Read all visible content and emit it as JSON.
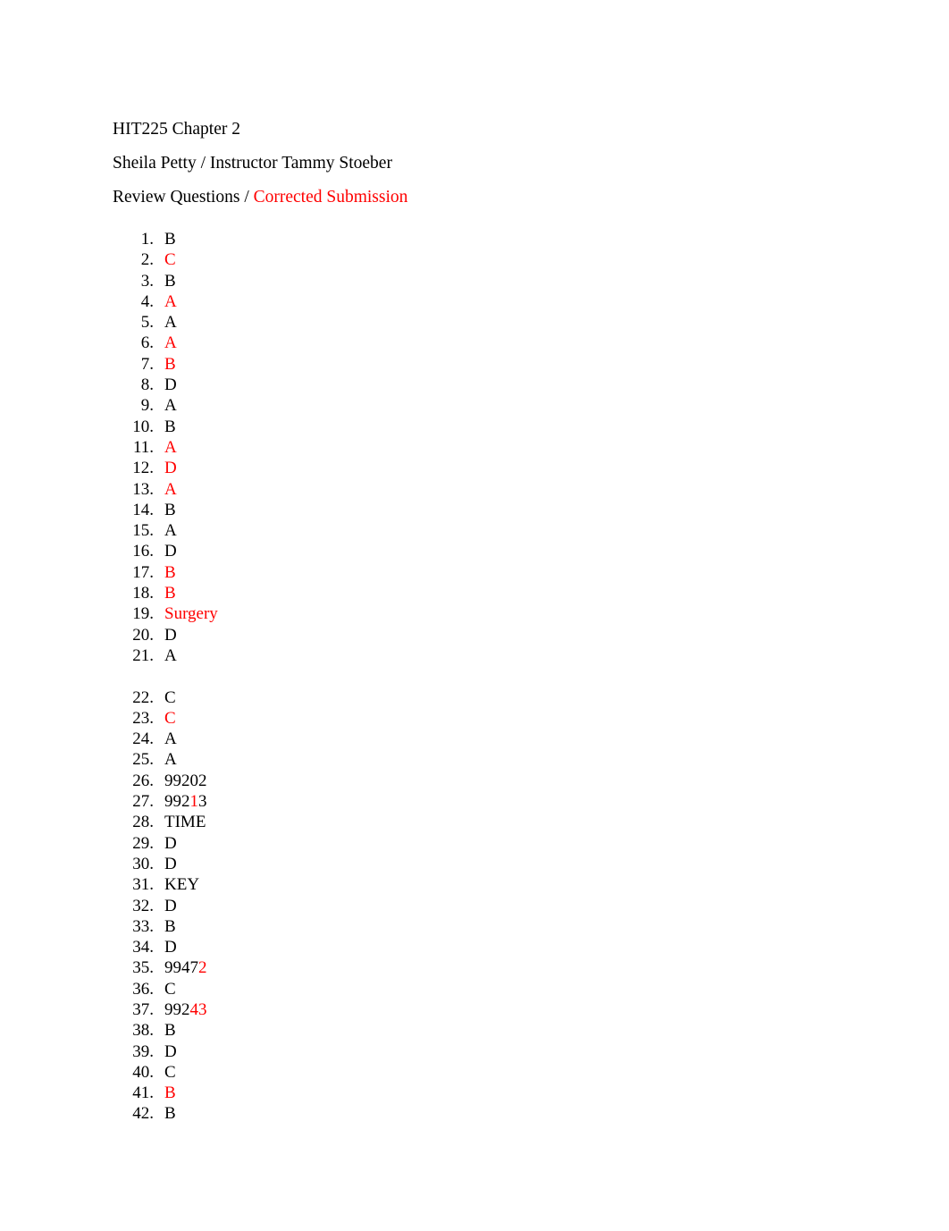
{
  "document": {
    "title": "HIT225 Chapter 2",
    "colors": {
      "text": "#000000",
      "correction": "#FF0000",
      "background": "#FFFFFF"
    },
    "header": {
      "line1": "HIT225 Chapter 2",
      "line2": "Sheila Petty / Instructor Tammy Stoeber",
      "line3_prefix": "Review Questions / ",
      "line3_red": "Corrected Submission"
    },
    "answers": [
      {
        "number": "1.",
        "value": "B",
        "color": "black",
        "gap_before": false
      },
      {
        "number": "2.",
        "value": "C",
        "color": "red",
        "gap_before": false
      },
      {
        "number": "3.",
        "value": "B",
        "color": "black",
        "gap_before": false
      },
      {
        "number": "4.",
        "value": "A",
        "color": "red",
        "gap_before": false
      },
      {
        "number": "5.",
        "value": "A",
        "color": "black",
        "gap_before": false
      },
      {
        "number": "6.",
        "value": "A",
        "color": "red",
        "gap_before": false
      },
      {
        "number": "7.",
        "value": "B",
        "color": "red",
        "gap_before": false
      },
      {
        "number": "8.",
        "value": "D",
        "color": "black",
        "gap_before": false
      },
      {
        "number": "9.",
        "value": "A",
        "color": "black",
        "gap_before": false
      },
      {
        "number": "10.",
        "value": "B",
        "color": "black",
        "gap_before": false
      },
      {
        "number": "11.",
        "value": "A",
        "color": "red",
        "gap_before": false
      },
      {
        "number": "12.",
        "value": "D",
        "color": "red",
        "gap_before": false
      },
      {
        "number": "13.",
        "value": "A",
        "color": "red",
        "gap_before": false
      },
      {
        "number": "14.",
        "value": "B",
        "color": "black",
        "gap_before": false
      },
      {
        "number": "15.",
        "value": "A",
        "color": "black",
        "gap_before": false
      },
      {
        "number": "16.",
        "value": "D",
        "color": "black",
        "gap_before": false
      },
      {
        "number": "17.",
        "value": "B",
        "color": "red",
        "gap_before": false
      },
      {
        "number": "18.",
        "value": "B",
        "color": "red",
        "gap_before": false
      },
      {
        "number": "19.",
        "value": "Surgery",
        "color": "red",
        "gap_before": false
      },
      {
        "number": "20.",
        "value": "D",
        "color": "black",
        "gap_before": false
      },
      {
        "number": "21.",
        "value": "A",
        "color": "black",
        "gap_before": false
      },
      {
        "number": "22.",
        "value": "C",
        "color": "black",
        "gap_before": true
      },
      {
        "number": "23.",
        "value": "C",
        "color": "red",
        "gap_before": false
      },
      {
        "number": "24.",
        "value": "A",
        "color": "black",
        "gap_before": false
      },
      {
        "number": "25.",
        "value": "A",
        "color": "black",
        "gap_before": false
      },
      {
        "number": "26.",
        "value": "99202",
        "color": "black",
        "gap_before": false
      },
      {
        "number": "27.",
        "value": "99213",
        "color": "mixed",
        "gap_before": false,
        "segments": [
          {
            "text": "992",
            "color": "black"
          },
          {
            "text": "1",
            "color": "red"
          },
          {
            "text": "3",
            "color": "black"
          }
        ]
      },
      {
        "number": "28.",
        "value": "TIME",
        "color": "black",
        "gap_before": false
      },
      {
        "number": "29.",
        "value": "D",
        "color": "black",
        "gap_before": false
      },
      {
        "number": "30.",
        "value": "D",
        "color": "black",
        "gap_before": false
      },
      {
        "number": "31.",
        "value": "KEY",
        "color": "black",
        "gap_before": false
      },
      {
        "number": "32.",
        "value": "D",
        "color": "black",
        "gap_before": false
      },
      {
        "number": "33.",
        "value": "B",
        "color": "black",
        "gap_before": false
      },
      {
        "number": "34.",
        "value": "D",
        "color": "black",
        "gap_before": false
      },
      {
        "number": "35.",
        "value": "99472",
        "color": "mixed",
        "gap_before": false,
        "segments": [
          {
            "text": "9947",
            "color": "black"
          },
          {
            "text": "2",
            "color": "red"
          }
        ]
      },
      {
        "number": "36.",
        "value": "C",
        "color": "black",
        "gap_before": false
      },
      {
        "number": "37.",
        "value": "99243",
        "color": "mixed",
        "gap_before": false,
        "segments": [
          {
            "text": "992",
            "color": "black"
          },
          {
            "text": "43",
            "color": "red"
          }
        ]
      },
      {
        "number": "38.",
        "value": "B",
        "color": "black",
        "gap_before": false
      },
      {
        "number": "39.",
        "value": "D",
        "color": "black",
        "gap_before": false
      },
      {
        "number": "40.",
        "value": "C",
        "color": "black",
        "gap_before": false
      },
      {
        "number": "41.",
        "value": "B",
        "color": "red",
        "gap_before": false
      },
      {
        "number": "42.",
        "value": "B",
        "color": "black",
        "gap_before": false
      }
    ]
  }
}
